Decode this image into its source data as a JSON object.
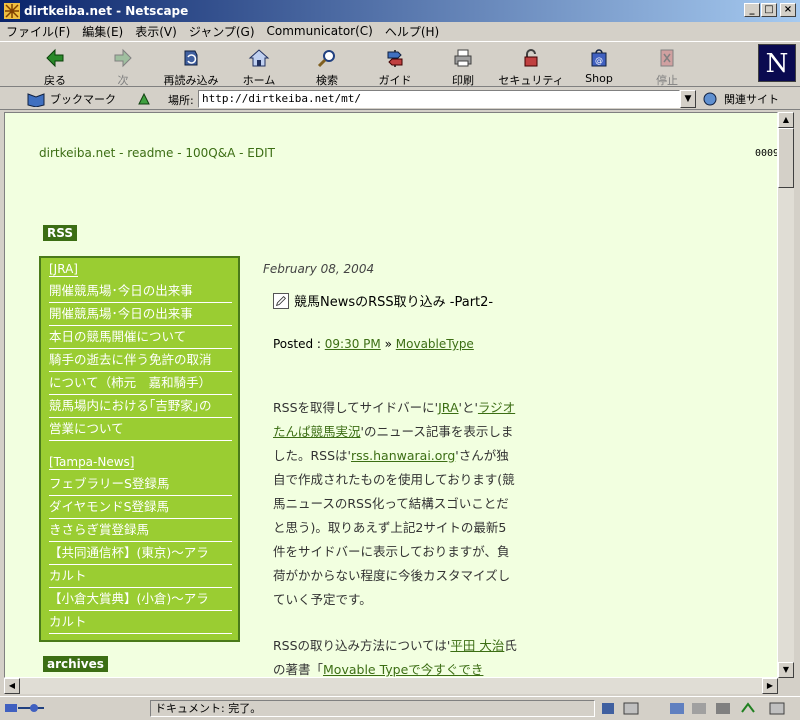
{
  "window": {
    "title": "dirtkeiba.net - Netscape",
    "controls": {
      "minimize": "_",
      "maximize": "□",
      "close": "×"
    }
  },
  "menu": [
    "ファイル(F)",
    "編集(E)",
    "表示(V)",
    "ジャンプ(G)",
    "Communicator(C)",
    "ヘルプ(H)"
  ],
  "toolbar": {
    "back": "戻る",
    "forward": "次",
    "reload": "再読み込み",
    "home": "ホーム",
    "search": "検索",
    "guide": "ガイド",
    "print": "印刷",
    "security": "セキュリティ",
    "shop": "Shop",
    "stop": "停止",
    "logo": "N"
  },
  "locationbar": {
    "bookmarks": "ブックマーク",
    "location_label": "場所:",
    "url": "http://dirtkeiba.net/mt/",
    "related": "関連サイト"
  },
  "page": {
    "nav": {
      "site": "dirtkeiba.net",
      "sep": " - ",
      "readme": "readme",
      "qa": "100Q&A",
      "edit": "EDIT"
    },
    "counter": "0009",
    "rss_label": "RSS",
    "archives_label": "archives",
    "sidebar": {
      "jra_heading": "[JRA]",
      "jra_items": [
        "開催競馬場･今日の出来事",
        "開催競馬場･今日の出来事",
        "本日の競馬開催について",
        "騎手の逝去に伴う免許の取消",
        "について（柿元　嘉和騎手）",
        "競馬場内における｢吉野家｣の",
        "営業について"
      ],
      "tampa_heading": "[Tampa-News]",
      "tampa_items": [
        "フェブラリーS登録馬",
        "ダイヤモンドS登録馬",
        "きさらぎ賞登録馬",
        "【共同通信杯】(東京)～アラ",
        "カルト",
        "【小倉大賞典】(小倉)～アラ",
        "カルト"
      ]
    },
    "entry": {
      "date": "February 08, 2004",
      "title": "競馬NewsのRSS取り込み -Part2-",
      "posted_label": "Posted : ",
      "posted_time": "09:30 PM",
      "posted_sep": " » ",
      "posted_category": "MovableType",
      "p1_a": "RSSを取得してサイドバーに'",
      "p1_link1": "JRA",
      "p1_b": "'と'",
      "p1_link2": "ラジオたんぱ競馬実況",
      "p1_c": "'のニュース記事を表示しました。RSSは'",
      "p1_link3": "rss.hanwarai.org",
      "p1_d": "'さんが独自で作成されたものを使用しております(競馬ニュースのRSS化って結構スゴいことだと思う)。取りあえず上記2サイトの最新5件をサイドバーに表示しておりますが、負荷がかからない程度に今後カスタマイズしていく予定です。",
      "p2_a": "RSSの取り込み方法については'",
      "p2_link1": "平田 大治",
      "p2_b": "氏の著書「",
      "p2_link2": "Movable Typeで今すぐでき"
    }
  },
  "status": {
    "text": "ドキュメント: 完了。"
  }
}
